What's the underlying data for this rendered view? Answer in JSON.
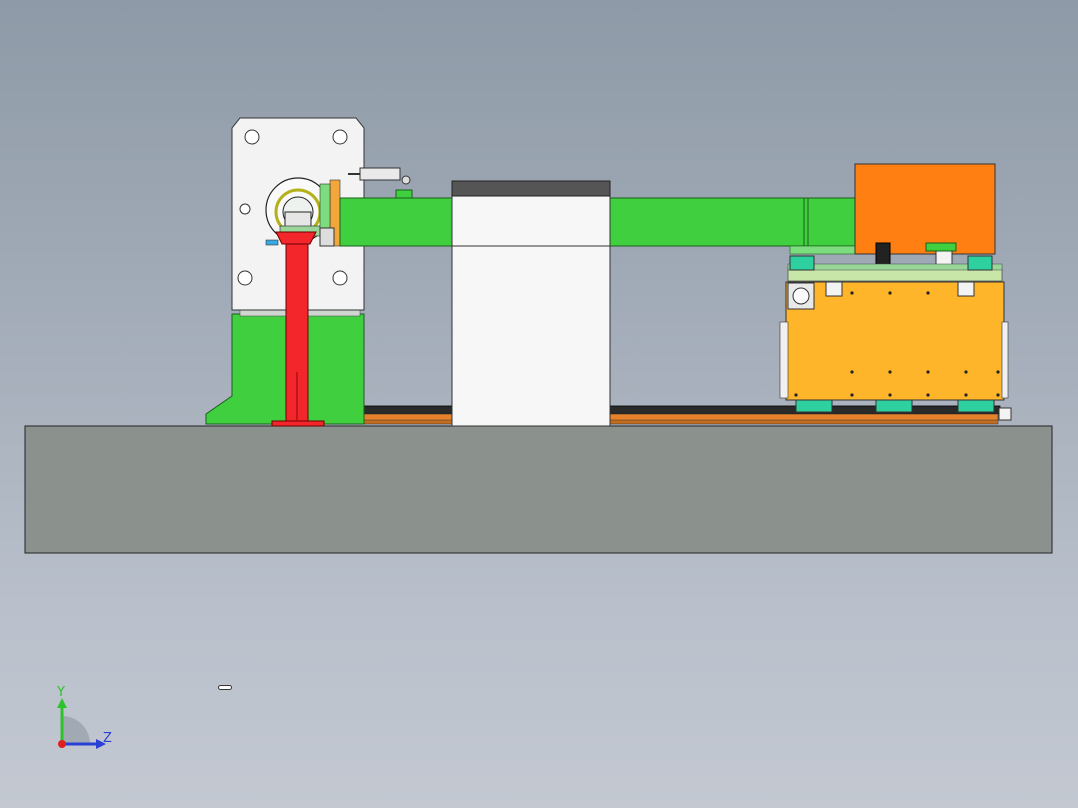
{
  "viewport": {
    "background_top": "#8e9aa7",
    "background_bottom": "#c3c8d1"
  },
  "model": {
    "description_colors": {
      "base": "#8b928d",
      "green": "#3fcf3f",
      "red": "#f2262b",
      "orange": "#ff7f12",
      "yellow": "#ffb52a",
      "white_plate": "#f2f2f2",
      "dark_cap": "#555555"
    }
  },
  "triad": {
    "y_label": "Y",
    "z_label": "Z",
    "y_color": "#2ec22e",
    "z_color": "#2a3fd6",
    "origin_color": "#e02020"
  }
}
